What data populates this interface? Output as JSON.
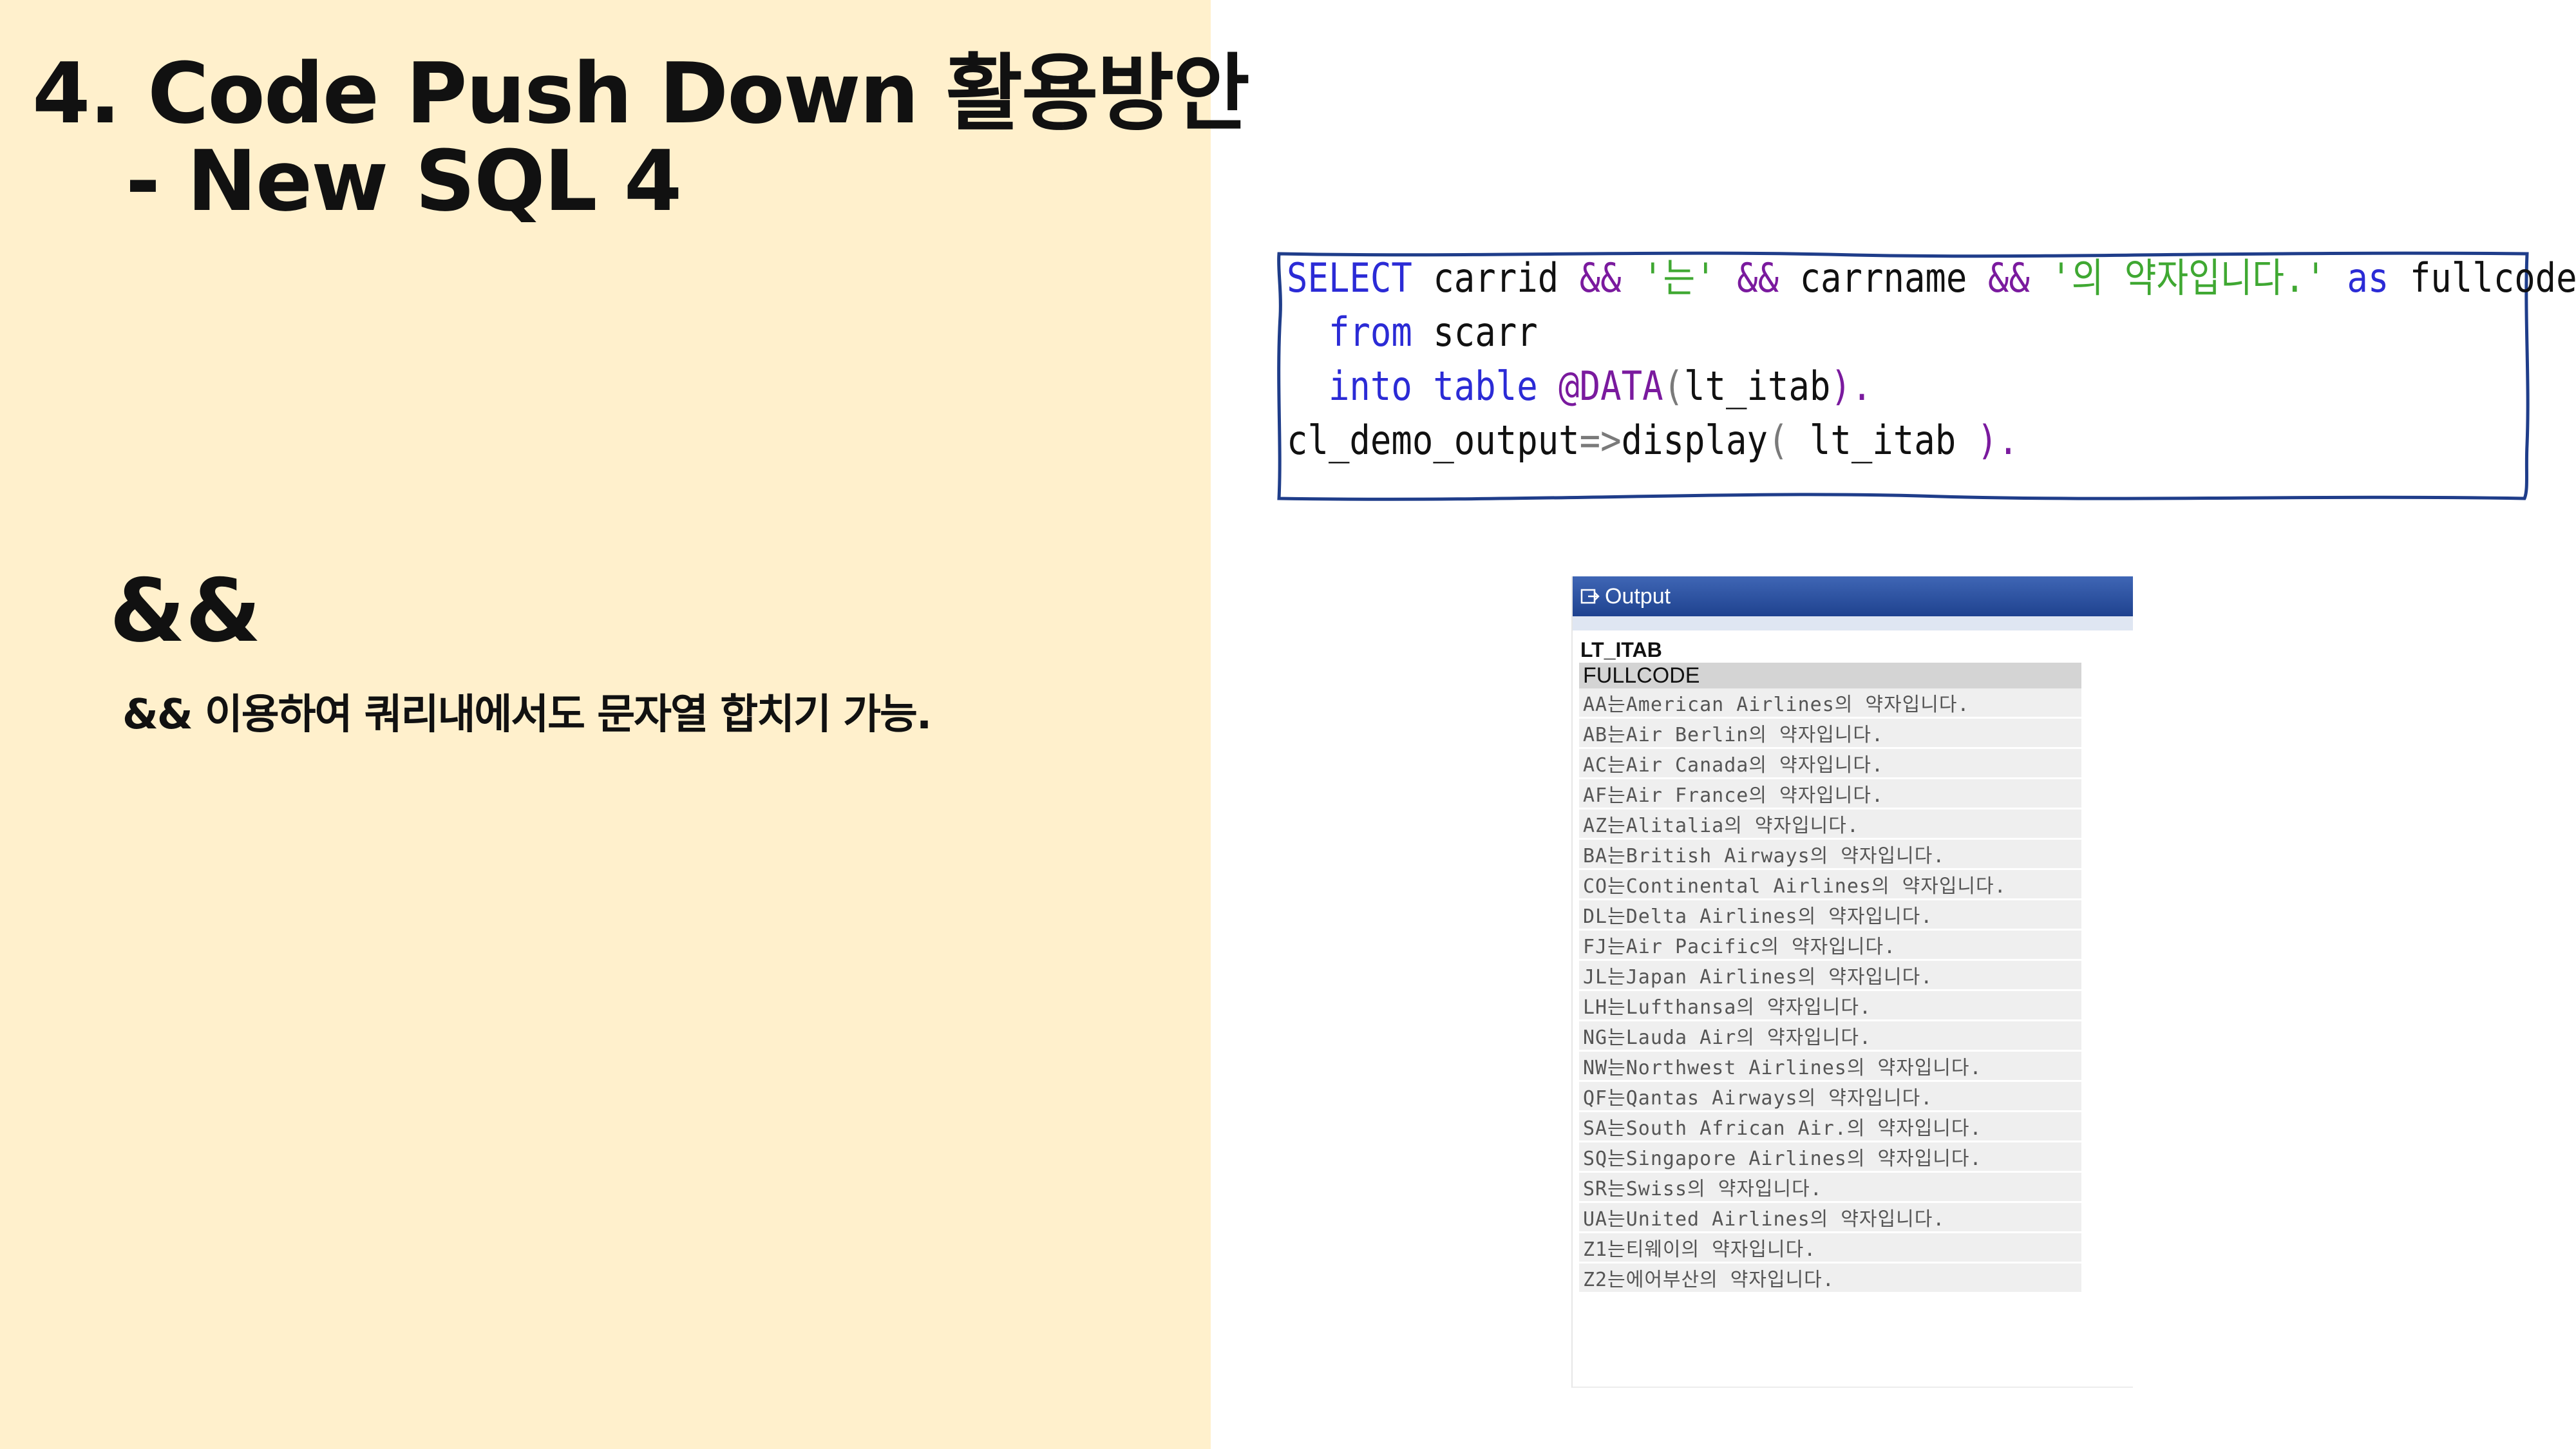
{
  "slide": {
    "title_line1": "4. Code Push Down 활용방안",
    "title_line2": "- New SQL 4",
    "operator_heading": "&&",
    "operator_description": "&& 이용하여 쿼리내에서도 문자열 합치기 가능.",
    "background_color": "#fff0cc"
  },
  "code": {
    "line1": {
      "kw1": "SELECT",
      "t1": " carrid ",
      "op1": "&&",
      "s1": " '는' ",
      "op2": "&&",
      "t2": " carrname ",
      "op3": "&&",
      "s2": " '의 약자입니다.' ",
      "kw2": "as",
      "t3": " fullcode"
    },
    "line2": {
      "indent": "  ",
      "kw": "from",
      "t": " scarr"
    },
    "line3": {
      "indent": "  ",
      "kw1": "into",
      "sp": " ",
      "kw2": "table",
      "sp2": " ",
      "op": "@DATA",
      "p1": "(",
      "t": "lt_itab",
      "p2": ")."
    },
    "line4": {
      "t1": "cl_demo_output",
      "p1": "=>",
      "t2": "display",
      "p2": "(",
      "t3": " lt_itab ",
      "p3": ")."
    }
  },
  "output_window": {
    "title": "Output",
    "table_name": "LT_ITAB",
    "column_header": "FULLCODE",
    "rows": [
      "AA는American Airlines의 약자입니다.",
      "AB는Air Berlin의 약자입니다.",
      "AC는Air Canada의 약자입니다.",
      "AF는Air France의 약자입니다.",
      "AZ는Alitalia의 약자입니다.",
      "BA는British Airways의 약자입니다.",
      "CO는Continental Airlines의 약자입니다.",
      "DL는Delta Airlines의 약자입니다.",
      "FJ는Air Pacific의 약자입니다.",
      "JL는Japan Airlines의 약자입니다.",
      "LH는Lufthansa의 약자입니다.",
      "NG는Lauda Air의 약자입니다.",
      "NW는Northwest Airlines의 약자입니다.",
      "QF는Qantas Airways의 약자입니다.",
      "SA는South African Air.의 약자입니다.",
      "SQ는Singapore Airlines의 약자입니다.",
      "SR는Swiss의 약자입니다.",
      "UA는United Airlines의 약자입니다.",
      "Z1는티웨이의 약자입니다.",
      "Z2는에어부산의 약자입니다."
    ]
  }
}
